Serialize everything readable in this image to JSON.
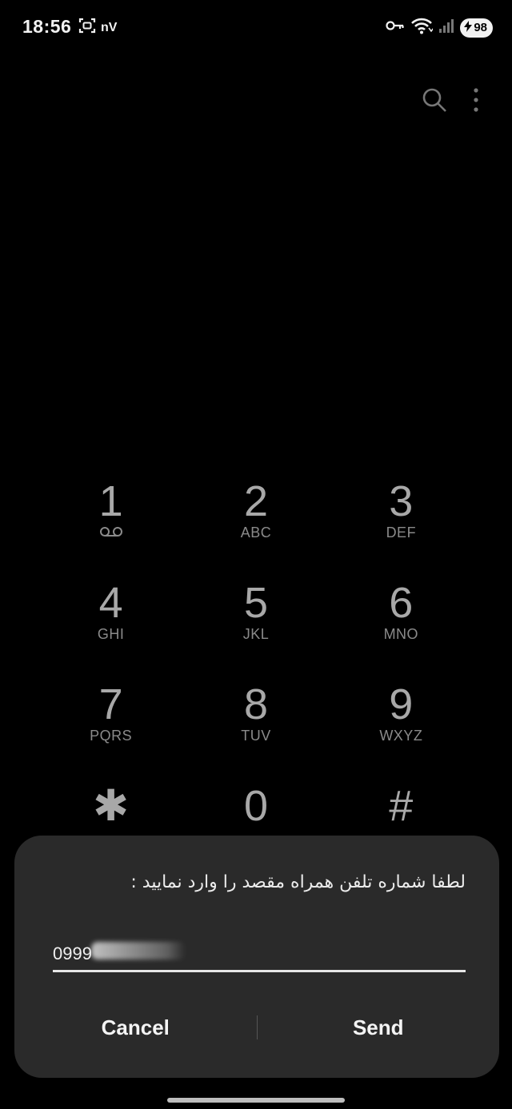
{
  "status_bar": {
    "time": "18:56",
    "network_label": "nV",
    "battery_level": "98",
    "icons": [
      "screenshot-icon",
      "vpn-key-icon",
      "wifi-icon",
      "signal-icon",
      "battery-charging-icon"
    ]
  },
  "top_actions": {
    "icons": [
      "search-icon",
      "more-options-icon"
    ]
  },
  "dialpad": {
    "keys": [
      {
        "digit": "1",
        "letters": ""
      },
      {
        "digit": "2",
        "letters": "ABC"
      },
      {
        "digit": "3",
        "letters": "DEF"
      },
      {
        "digit": "4",
        "letters": "GHI"
      },
      {
        "digit": "5",
        "letters": "JKL"
      },
      {
        "digit": "6",
        "letters": "MNO"
      },
      {
        "digit": "7",
        "letters": "PQRS"
      },
      {
        "digit": "8",
        "letters": "TUV"
      },
      {
        "digit": "9",
        "letters": "WXYZ"
      },
      {
        "digit": "✱",
        "letters": ""
      },
      {
        "digit": "0",
        "letters": ""
      },
      {
        "digit": "#",
        "letters": ""
      }
    ]
  },
  "dialog": {
    "message": "لطفا شماره تلفن همراه مقصد را وارد نمایید :",
    "input_value": "0999",
    "cancel_label": "Cancel",
    "send_label": "Send"
  },
  "colors": {
    "background": "#000000",
    "dialog_bg": "#2a2a2a",
    "dialpad_text": "#a8a8a8"
  }
}
